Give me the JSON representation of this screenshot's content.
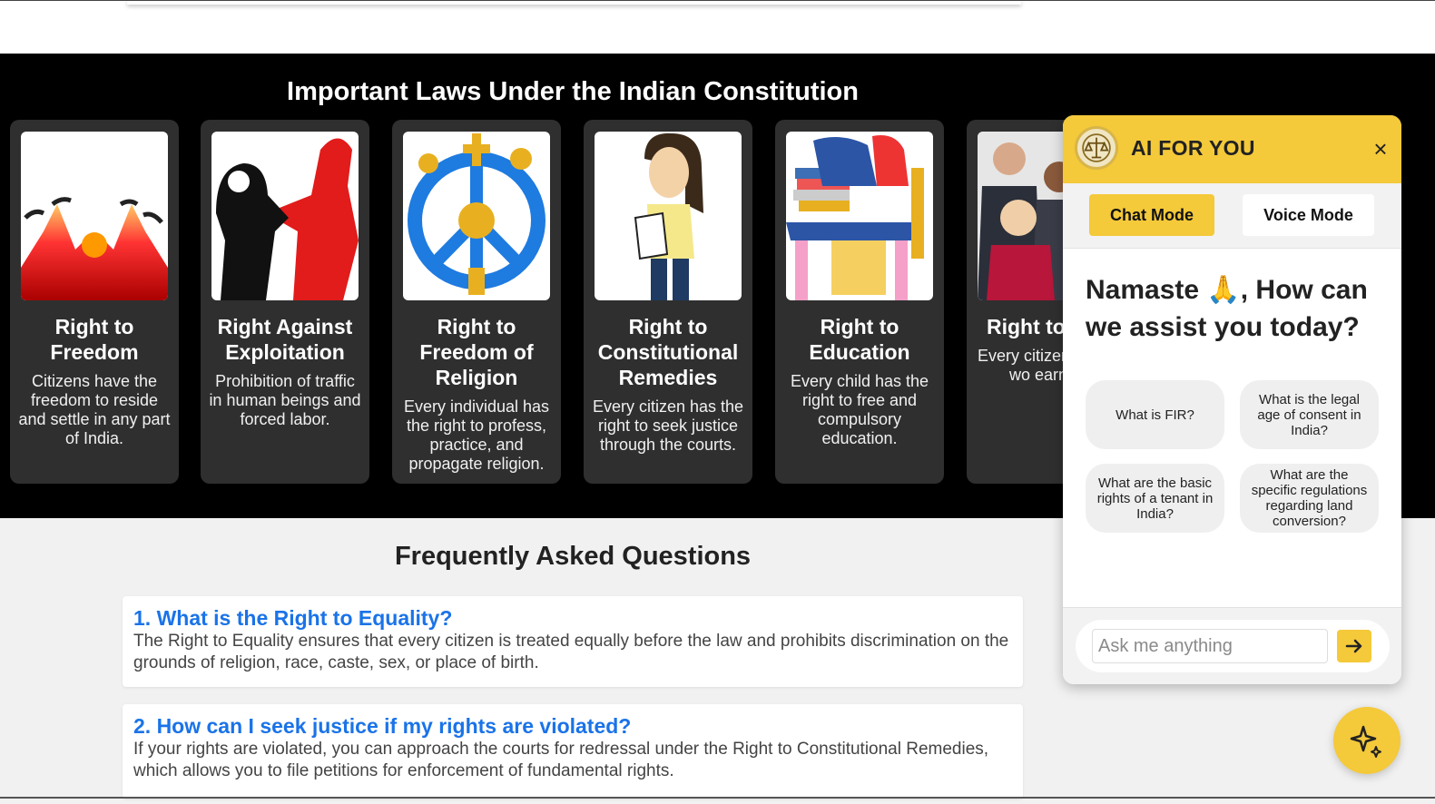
{
  "laws": {
    "title": "Important Laws Under the Indian Constitution",
    "cards": [
      {
        "title": "Right to Freedom",
        "description": "Citizens have the freedom to reside and settle in any part of India."
      },
      {
        "title": "Right Against Exploitation",
        "description": "Prohibition of traffic in human beings and forced labor."
      },
      {
        "title": "Right to Freedom of Religion",
        "description": "Every individual has the right to profess, practice, and propagate religion."
      },
      {
        "title": "Right to Constitutional Remedies",
        "description": "Every citizen has the right to seek justice through the courts."
      },
      {
        "title": "Right to Education",
        "description": "Every child has the right to free and compulsory education."
      },
      {
        "title": "Right to",
        "description": "Every citizen right to wo earn a li"
      }
    ]
  },
  "faq": {
    "title": "Frequently Asked Questions",
    "items": [
      {
        "question": "1. What is the Right to Equality?",
        "answer": "The Right to Equality ensures that every citizen is treated equally before the law and prohibits discrimination on the grounds of religion, race, caste, sex, or place of birth."
      },
      {
        "question": "2. How can I seek justice if my rights are violated?",
        "answer": "If your rights are violated, you can approach the courts for redressal under the Right to Constitutional Remedies, which allows you to file petitions for enforcement of fundamental rights."
      }
    ]
  },
  "chat": {
    "title": "AI FOR YOU",
    "close_label": "×",
    "modes": {
      "chat": "Chat Mode",
      "voice": "Voice Mode"
    },
    "greeting": "Namaste 🙏, How can we assist you today?",
    "suggestions": [
      "What is FIR?",
      "What is the legal age of consent in India?",
      "What are the basic rights of a tenant in India?",
      "What are the specific regulations regarding land conversion?"
    ],
    "input_placeholder": "Ask me anything",
    "accent_color": "#f4c93a",
    "icons": {
      "logo": "scales-of-justice-logo",
      "send": "arrow-right-icon",
      "fab": "sparkle-icon"
    }
  }
}
